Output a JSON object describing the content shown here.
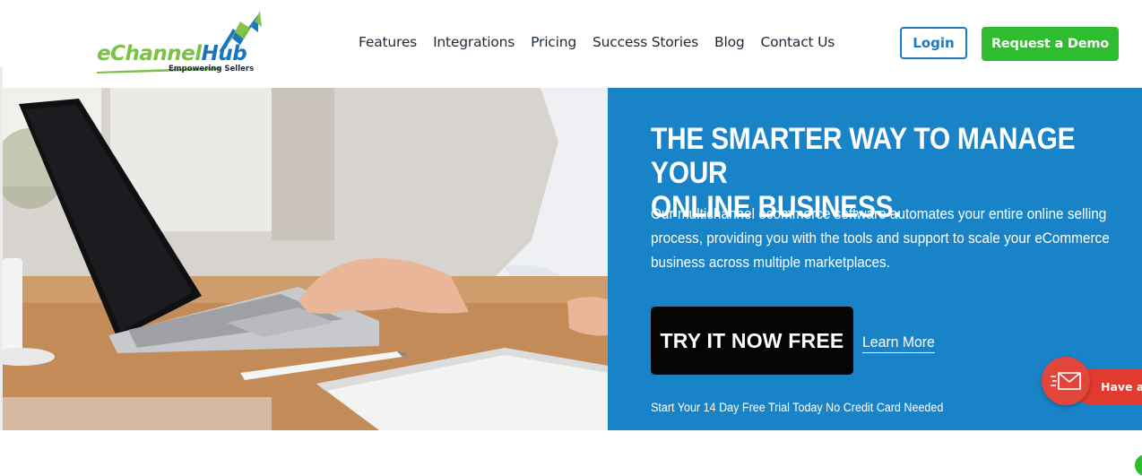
{
  "header": {
    "logo": {
      "brand_part1": "eChannel",
      "brand_part2": "Hub",
      "tagline": "Empowering Sellers"
    },
    "nav": [
      "Features",
      "Integrations",
      "Pricing",
      "Success Stories",
      "Blog",
      "Contact Us"
    ],
    "login_label": "Login",
    "demo_label": "Request a Demo"
  },
  "hero": {
    "title_line1": "THE SMARTER WAY TO MANAGE YOUR",
    "title_line2": "ONLINE BUSINESS.",
    "description": "Our multichannel ecommerce software automates your entire online selling process, providing you with the tools and support to scale your eCommerce business across multiple marketplaces.",
    "cta_label": "TRY IT NOW FREE",
    "learn_more_label": "Learn More",
    "trial_note": "Start Your 14 Day Free Trial Today No Credit Card Needed"
  },
  "chat_widget": {
    "label": "Have a question?",
    "icon": "envelope-icon"
  },
  "colors": {
    "primary_blue": "#1983c8",
    "green": "#2ebd2e",
    "logo_green": "#7bc143",
    "chat_red": "#e23a2e"
  }
}
